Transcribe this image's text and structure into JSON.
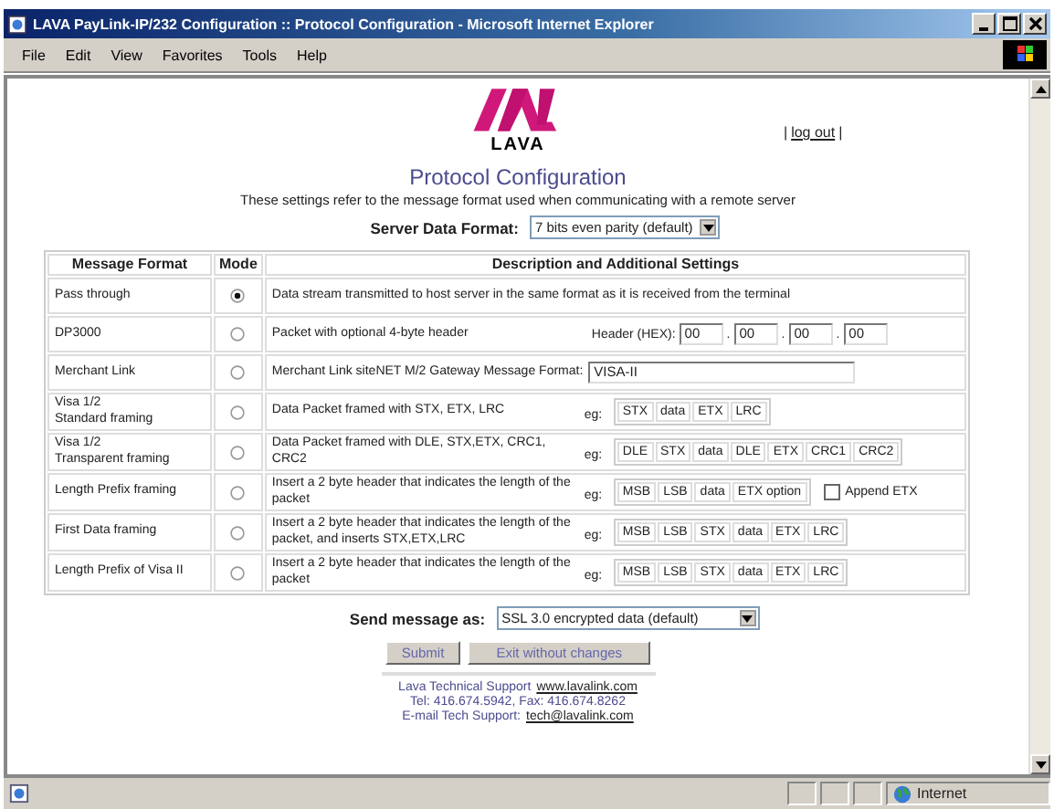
{
  "window": {
    "title": "LAVA PayLink-IP/232 Configuration :: Protocol Configuration - Microsoft Internet Explorer"
  },
  "menu": [
    "File",
    "Edit",
    "View",
    "Favorites",
    "Tools",
    "Help"
  ],
  "logo": {
    "text": "LAVA"
  },
  "logout": {
    "prefix": "|",
    "link": "log out",
    "suffix": "|"
  },
  "heading": "Protocol Configuration",
  "subheading": "These settings refer to the message format used when communicating with a remote server",
  "server_format": {
    "label": "Server Data Format:",
    "value": "7 bits even parity (default)"
  },
  "table": {
    "columns": [
      "Message Format",
      "Mode",
      "Description and Additional Settings"
    ],
    "rows": [
      {
        "name": "Pass through",
        "selected": true,
        "kind": "text",
        "description": "Data stream transmitted to host server in the same format as it is received from the terminal"
      },
      {
        "name": "DP3000",
        "selected": false,
        "kind": "hex",
        "description": "Packet with optional 4-byte header",
        "label": "Header (HEX):",
        "fields": [
          "00",
          "00",
          "00",
          "00"
        ],
        "separators": [
          ".",
          ".",
          "."
        ]
      },
      {
        "name": "Merchant Link",
        "selected": false,
        "kind": "input",
        "description": "Merchant Link siteNET M/2 Gateway Message Format:",
        "value": "VISA-II"
      },
      {
        "name": "Visa 1/2\nStandard framing",
        "selected": false,
        "kind": "frame",
        "description": "Data Packet framed with STX, ETX, LRC",
        "eg": "eg:",
        "cells": [
          "STX",
          "data",
          "ETX",
          "LRC"
        ]
      },
      {
        "name": "Visa 1/2\nTransparent framing",
        "selected": false,
        "kind": "frame",
        "description": "Data Packet framed with DLE, STX,ETX, CRC1, CRC2",
        "eg": "eg:",
        "cells": [
          "DLE",
          "STX",
          "data",
          "DLE",
          "ETX",
          "CRC1",
          "CRC2"
        ]
      },
      {
        "name": "Length Prefix framing",
        "selected": false,
        "kind": "frame",
        "description": "Insert a 2 byte header that indicates the length of the packet",
        "eg": "eg:",
        "cells": [
          "MSB",
          "LSB",
          "data",
          "ETX option"
        ],
        "checkbox": {
          "label": "Append ETX",
          "checked": false
        }
      },
      {
        "name": "First Data framing",
        "selected": false,
        "kind": "frame",
        "description": "Insert a 2 byte header that indicates the length of the packet, and inserts STX,ETX,LRC",
        "eg": "eg:",
        "cells": [
          "MSB",
          "LSB",
          "STX",
          "data",
          "ETX",
          "LRC"
        ]
      },
      {
        "name": "Length Prefix of Visa II",
        "selected": false,
        "kind": "frame",
        "description": "Insert a 2 byte header that indicates the length of the packet",
        "eg": "eg:",
        "cells": [
          "MSB",
          "LSB",
          "STX",
          "data",
          "ETX",
          "LRC"
        ]
      }
    ]
  },
  "send_as": {
    "label": "Send message as:",
    "value": "SSL 3.0 encrypted data (default)"
  },
  "buttons": [
    "Submit",
    "Exit without changes"
  ],
  "footer": [
    {
      "text": "Lava Technical Support",
      "link": "www.lavalink.com"
    },
    {
      "text": "Tel: 416.674.5942, Fax: 416.674.8262"
    },
    {
      "text": "E-mail Tech Support:",
      "link": "tech@lavalink.com"
    }
  ],
  "status_bar": {
    "zone": "Internet"
  }
}
